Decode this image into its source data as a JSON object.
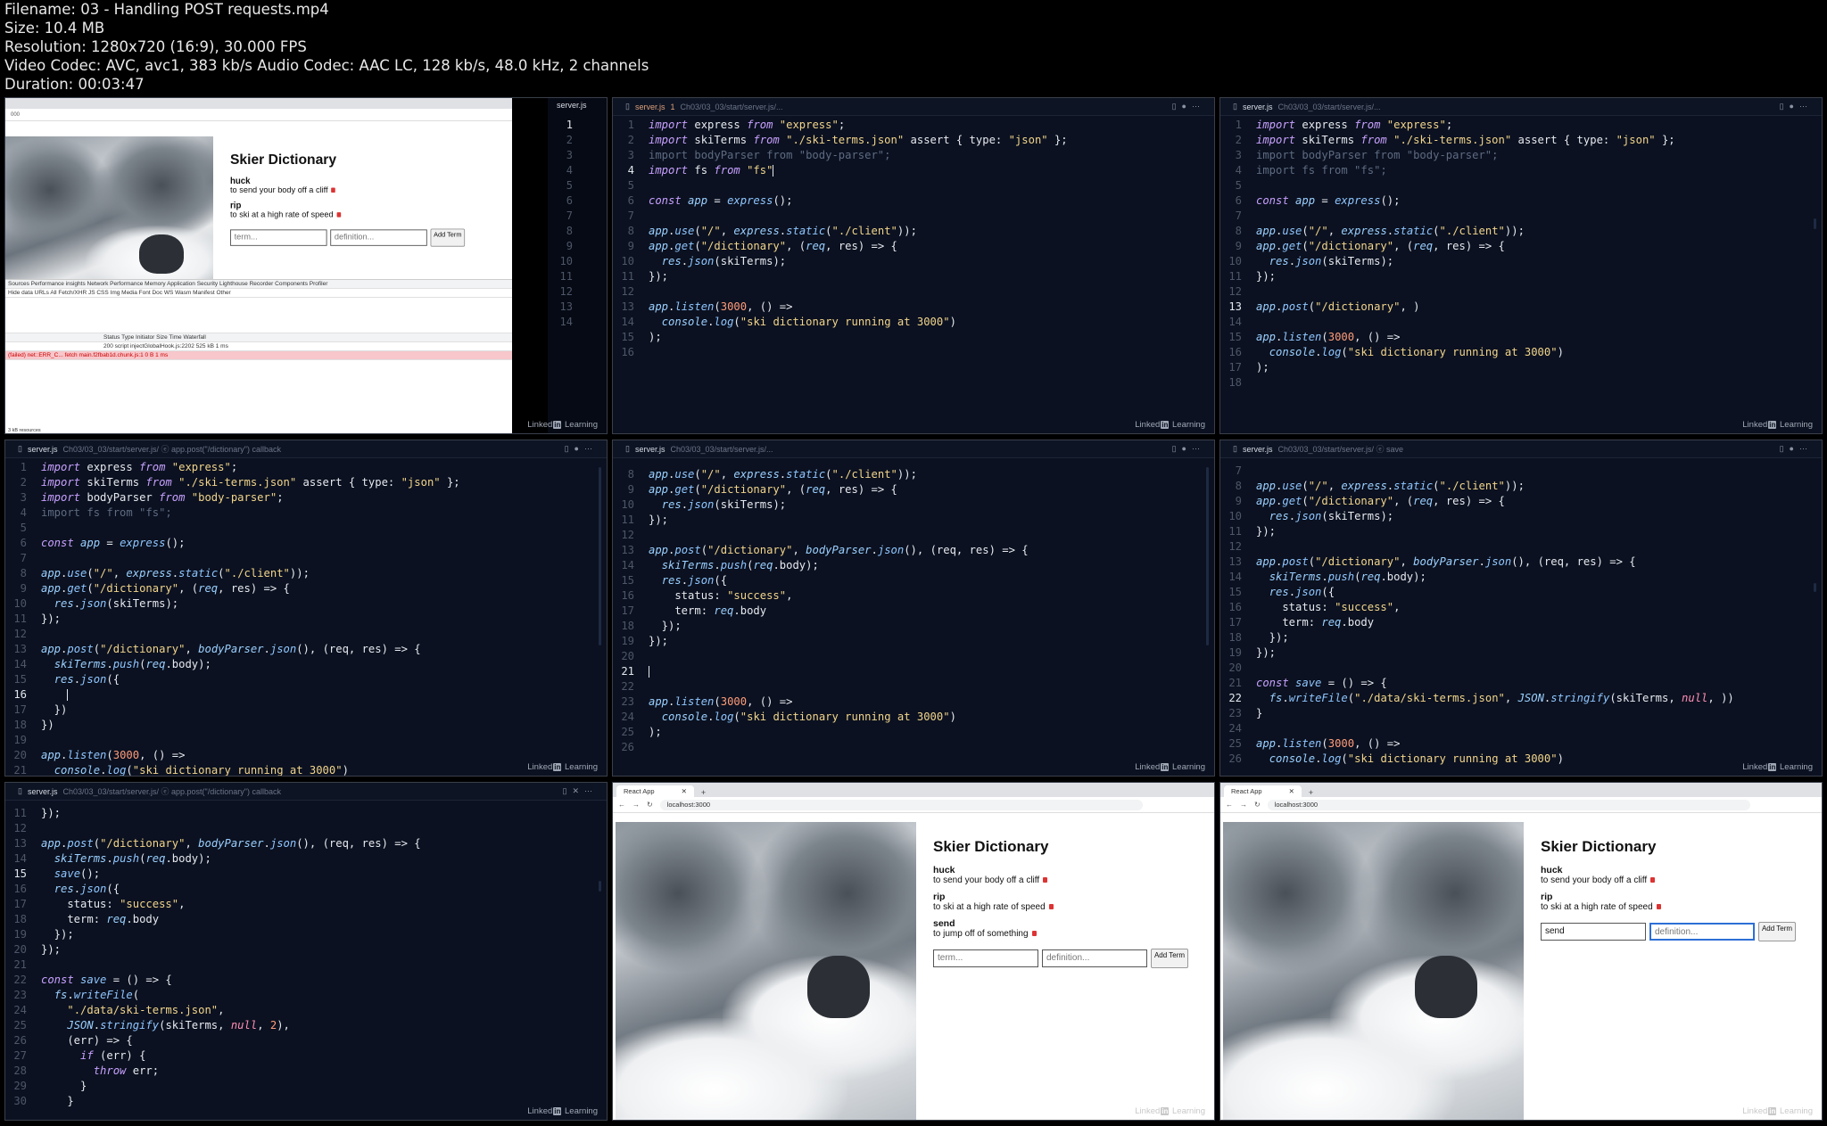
{
  "meta": {
    "filename": "Filename: 03 - Handling POST requests.mp4",
    "size": "Size: 10.4 MB",
    "resolution": "Resolution: 1280x720 (16:9), 30.000 FPS",
    "video": "Video Codec: AVC, avc1, 383 kb/s Audio Codec: AAC LC, 128 kb/s, 48.0 kHz, 2 channels",
    "duration": "Duration: 00:03:47"
  },
  "watermark": "Linked",
  "watermark_in": "in",
  "watermark_tail": "Learning",
  "tiles": {
    "t1": {
      "browser_url": "000",
      "title": "Skier Dictionary",
      "terms": [
        {
          "term": "huck",
          "def": "to send your body off a cliff"
        },
        {
          "term": "rip",
          "def": "to ski at a high rate of speed"
        }
      ],
      "term_ph": "term...",
      "def_ph": "definition...",
      "btn": "Add Term",
      "devtabs": "Sources  Performance insights  Network  Performance  Memory  Application  Security  Lighthouse  Recorder  Components  Profiler",
      "devfilter": "Hide data URLs  All  Fetch/XHR  JS  CSS  Img  Media  Font  Doc  WS  Wasm  Manifest  Other",
      "cols": "Status   Type   Initiator   Size   Time   Waterfall",
      "row1": "200   script   injectGlobalHook.js:2202   525 kB   1 ms",
      "row2": "(failed) net::ERR_C...   fetch   main.f2fbab1d.chunk.js:1   0 B   1 ms",
      "footer": "3 kB resources",
      "side_file": "server.js",
      "side_nums": [
        "1",
        "2",
        "3",
        "4",
        "5",
        "6",
        "7",
        "8",
        "9",
        "10",
        "11",
        "12",
        "13",
        "14"
      ]
    },
    "t2": {
      "file": "server.js",
      "mod": "1",
      "path": "Ch03/03_03/start/server.js/..."
    },
    "t3": {
      "file": "server.js",
      "path": "Ch03/03_03/start/server.js/..."
    },
    "t4": {
      "file": "server.js",
      "path": "Ch03/03_03/start/server.js/ ⓔ app.post(\"/dictionary\") callback"
    },
    "t5": {
      "file": "server.js",
      "path": "Ch03/03_03/start/server.js/..."
    },
    "t6": {
      "file": "server.js",
      "path": "Ch03/03_03/start/server.js/ ⓔ save"
    },
    "t7": {
      "file": "server.js",
      "path": "Ch03/03_03/start/server.js/ ⓔ app.post(\"/dictionary\") callback"
    },
    "t8": {
      "tab": "React App",
      "url": "localhost:3000",
      "title": "Skier Dictionary",
      "terms": [
        {
          "term": "huck",
          "def": "to send your body off a cliff"
        },
        {
          "term": "rip",
          "def": "to ski at a high rate of speed"
        },
        {
          "term": "send",
          "def": "to jump off of something"
        }
      ],
      "term_ph": "term...",
      "def_ph": "definition...",
      "btn": "Add Term"
    },
    "t9": {
      "tab": "React App",
      "url": "localhost:3000",
      "title": "Skier Dictionary",
      "terms": [
        {
          "term": "huck",
          "def": "to send your body off a cliff"
        },
        {
          "term": "rip",
          "def": "to ski at a high rate of speed"
        }
      ],
      "term_value": "send",
      "def_ph": "definition...",
      "btn": "Add Term"
    }
  },
  "code": {
    "t2": [
      {
        "n": "1",
        "h": "<span class='c-imp'>import</span> express <span class='c-imp'>from</span> <span class='c-str'>\"express\"</span>;"
      },
      {
        "n": "2",
        "h": "<span class='c-imp'>import</span> skiTerms <span class='c-imp'>from</span> <span class='c-str'>\"./ski-terms.json\"</span> assert { type: <span class='c-str'>\"json\"</span> };"
      },
      {
        "n": "3",
        "h": "<span class='c-dim'>import bodyParser from \"body-parser\";</span>"
      },
      {
        "n": "4",
        "c": 1,
        "h": "<span class='c-imp'>import</span> fs <span class='c-imp'>from</span> <span class='c-str'>\"fs\"</span><span class='cursor'></span>"
      },
      {
        "n": "5",
        "h": ""
      },
      {
        "n": "6",
        "h": "<span class='c-kw'>const</span> <span class='c-var'>app</span> = <span class='c-fn'>express</span>();"
      },
      {
        "n": "7",
        "h": ""
      },
      {
        "n": "8",
        "h": "<span class='c-var'>app</span>.<span class='c-fn'>use</span>(<span class='c-str'>\"/\"</span>, <span class='c-var'>express</span>.<span class='c-fn'>static</span>(<span class='c-str'>\"./client\"</span>));"
      },
      {
        "n": "9",
        "h": "<span class='c-var'>app</span>.<span class='c-fn'>get</span>(<span class='c-str'>\"/dictionary\"</span>, (<span class='c-var'>req</span>, res) => {"
      },
      {
        "n": "10",
        "h": "  <span class='c-var'>res</span>.<span class='c-fn'>json</span>(skiTerms);"
      },
      {
        "n": "11",
        "h": "});"
      },
      {
        "n": "12",
        "h": ""
      },
      {
        "n": "13",
        "h": "<span class='c-var'>app</span>.<span class='c-fn'>listen</span>(<span class='c-num'>3000</span>, () =>"
      },
      {
        "n": "14",
        "h": "  <span class='c-var'>console</span>.<span class='c-fn'>log</span>(<span class='c-str'>\"ski dictionary running at 3000\"</span>)"
      },
      {
        "n": "15",
        "h": ");"
      },
      {
        "n": "16",
        "h": ""
      }
    ],
    "t3": [
      {
        "n": "1",
        "h": "<span class='c-imp'>import</span> express <span class='c-imp'>from</span> <span class='c-str'>\"express\"</span>;"
      },
      {
        "n": "2",
        "h": "<span class='c-imp'>import</span> skiTerms <span class='c-imp'>from</span> <span class='c-str'>\"./ski-terms.json\"</span> assert { type: <span class='c-str'>\"json\"</span> };"
      },
      {
        "n": "3",
        "h": "<span class='c-dim'>import bodyParser from \"body-parser\";</span>"
      },
      {
        "n": "4",
        "h": "<span class='c-dim'>import fs from \"fs\";</span>"
      },
      {
        "n": "5",
        "h": ""
      },
      {
        "n": "6",
        "h": "<span class='c-kw'>const</span> <span class='c-var'>app</span> = <span class='c-fn'>express</span>();"
      },
      {
        "n": "7",
        "h": ""
      },
      {
        "n": "8",
        "h": "<span class='c-var'>app</span>.<span class='c-fn'>use</span>(<span class='c-str'>\"/\"</span>, <span class='c-var'>express</span>.<span class='c-fn'>static</span>(<span class='c-str'>\"./client\"</span>));"
      },
      {
        "n": "9",
        "h": "<span class='c-var'>app</span>.<span class='c-fn'>get</span>(<span class='c-str'>\"/dictionary\"</span>, (<span class='c-var'>req</span>, res) => {"
      },
      {
        "n": "10",
        "h": "  <span class='c-var'>res</span>.<span class='c-fn'>json</span>(skiTerms);"
      },
      {
        "n": "11",
        "h": "});"
      },
      {
        "n": "12",
        "h": ""
      },
      {
        "n": "13",
        "c": 1,
        "h": "<span class='c-var'>app</span>.<span class='c-fn'>post</span>(<span class='c-str'>\"/dictionary\"</span>, )"
      },
      {
        "n": "14",
        "h": ""
      },
      {
        "n": "15",
        "h": "<span class='c-var'>app</span>.<span class='c-fn'>listen</span>(<span class='c-num'>3000</span>, () =>"
      },
      {
        "n": "16",
        "h": "  <span class='c-var'>console</span>.<span class='c-fn'>log</span>(<span class='c-str'>\"ski dictionary running at 3000\"</span>)"
      },
      {
        "n": "17",
        "h": ");"
      },
      {
        "n": "18",
        "h": ""
      }
    ],
    "t4": [
      {
        "n": "1",
        "h": "<span class='c-imp'>import</span> express <span class='c-imp'>from</span> <span class='c-str'>\"express\"</span>;"
      },
      {
        "n": "2",
        "h": "<span class='c-imp'>import</span> skiTerms <span class='c-imp'>from</span> <span class='c-str'>\"./ski-terms.json\"</span> assert { type: <span class='c-str'>\"json\"</span> };"
      },
      {
        "n": "3",
        "h": "<span class='c-imp'>import</span> bodyParser <span class='c-imp'>from</span> <span class='c-str'>\"body-parser\"</span>;"
      },
      {
        "n": "4",
        "h": "<span class='c-dim'>import fs from \"fs\";</span>"
      },
      {
        "n": "5",
        "h": ""
      },
      {
        "n": "6",
        "h": "<span class='c-kw'>const</span> <span class='c-var'>app</span> = <span class='c-fn'>express</span>();"
      },
      {
        "n": "7",
        "h": ""
      },
      {
        "n": "8",
        "h": "<span class='c-var'>app</span>.<span class='c-fn'>use</span>(<span class='c-str'>\"/\"</span>, <span class='c-var'>express</span>.<span class='c-fn'>static</span>(<span class='c-str'>\"./client\"</span>));"
      },
      {
        "n": "9",
        "h": "<span class='c-var'>app</span>.<span class='c-fn'>get</span>(<span class='c-str'>\"/dictionary\"</span>, (<span class='c-var'>req</span>, res) => {"
      },
      {
        "n": "10",
        "h": "  <span class='c-var'>res</span>.<span class='c-fn'>json</span>(skiTerms);"
      },
      {
        "n": "11",
        "h": "});"
      },
      {
        "n": "12",
        "h": ""
      },
      {
        "n": "13",
        "h": "<span class='c-var'>app</span>.<span class='c-fn'>post</span>(<span class='c-str'>\"/dictionary\"</span>, <span class='c-var'>bodyParser</span>.<span class='c-fn'>json</span>(), (req, res) => {"
      },
      {
        "n": "14",
        "h": "  <span class='c-var'>skiTerms</span>.<span class='c-fn'>push</span>(<span class='c-var'>req</span>.body);"
      },
      {
        "n": "15",
        "h": "  <span class='c-var'>res</span>.<span class='c-fn'>json</span>({"
      },
      {
        "n": "16",
        "c": 1,
        "h": "    <span class='cursor'></span>"
      },
      {
        "n": "17",
        "h": "  })"
      },
      {
        "n": "18",
        "h": "})"
      },
      {
        "n": "19",
        "h": ""
      },
      {
        "n": "20",
        "h": "<span class='c-var'>app</span>.<span class='c-fn'>listen</span>(<span class='c-num'>3000</span>, () =>"
      },
      {
        "n": "21",
        "h": "  <span class='c-var'>console</span>.<span class='c-fn'>log</span>(<span class='c-str'>\"ski dictionary running at 3000\"</span>)"
      }
    ],
    "t5": [
      {
        "n": "8",
        "h": "<span class='c-var'>app</span>.<span class='c-fn'>use</span>(<span class='c-str'>\"/\"</span>, <span class='c-var'>express</span>.<span class='c-fn'>static</span>(<span class='c-str'>\"./client\"</span>));"
      },
      {
        "n": "9",
        "h": "<span class='c-var'>app</span>.<span class='c-fn'>get</span>(<span class='c-str'>\"/dictionary\"</span>, (<span class='c-var'>req</span>, res) => {"
      },
      {
        "n": "10",
        "h": "  <span class='c-var'>res</span>.<span class='c-fn'>json</span>(skiTerms);"
      },
      {
        "n": "11",
        "h": "});"
      },
      {
        "n": "12",
        "h": ""
      },
      {
        "n": "13",
        "h": "<span class='c-var'>app</span>.<span class='c-fn'>post</span>(<span class='c-str'>\"/dictionary\"</span>, <span class='c-var'>bodyParser</span>.<span class='c-fn'>json</span>(), (req, res) => {"
      },
      {
        "n": "14",
        "h": "  <span class='c-var'>skiTerms</span>.<span class='c-fn'>push</span>(<span class='c-var'>req</span>.body);"
      },
      {
        "n": "15",
        "h": "  <span class='c-var'>res</span>.<span class='c-fn'>json</span>({"
      },
      {
        "n": "16",
        "h": "    status: <span class='c-str'>\"success\"</span>,"
      },
      {
        "n": "17",
        "h": "    term: <span class='c-var'>req</span>.body"
      },
      {
        "n": "18",
        "h": "  });"
      },
      {
        "n": "19",
        "h": "});"
      },
      {
        "n": "20",
        "h": ""
      },
      {
        "n": "21",
        "c": 1,
        "h": "<span class='cursor'></span>"
      },
      {
        "n": "22",
        "h": ""
      },
      {
        "n": "23",
        "h": "<span class='c-var'>app</span>.<span class='c-fn'>listen</span>(<span class='c-num'>3000</span>, () =>"
      },
      {
        "n": "24",
        "h": "  <span class='c-var'>console</span>.<span class='c-fn'>log</span>(<span class='c-str'>\"ski dictionary running at 3000\"</span>)"
      },
      {
        "n": "25",
        "h": ");"
      },
      {
        "n": "26",
        "h": ""
      }
    ],
    "t6": [
      {
        "n": "7",
        "h": ""
      },
      {
        "n": "8",
        "h": "<span class='c-var'>app</span>.<span class='c-fn'>use</span>(<span class='c-str'>\"/\"</span>, <span class='c-var'>express</span>.<span class='c-fn'>static</span>(<span class='c-str'>\"./client\"</span>));"
      },
      {
        "n": "9",
        "h": "<span class='c-var'>app</span>.<span class='c-fn'>get</span>(<span class='c-str'>\"/dictionary\"</span>, (<span class='c-var'>req</span>, res) => {"
      },
      {
        "n": "10",
        "h": "  <span class='c-var'>res</span>.<span class='c-fn'>json</span>(skiTerms);"
      },
      {
        "n": "11",
        "h": "});"
      },
      {
        "n": "12",
        "h": ""
      },
      {
        "n": "13",
        "h": "<span class='c-var'>app</span>.<span class='c-fn'>post</span>(<span class='c-str'>\"/dictionary\"</span>, <span class='c-var'>bodyParser</span>.<span class='c-fn'>json</span>(), (req, res) => {"
      },
      {
        "n": "14",
        "h": "  <span class='c-var'>skiTerms</span>.<span class='c-fn'>push</span>(<span class='c-var'>req</span>.body);"
      },
      {
        "n": "15",
        "h": "  <span class='c-var'>res</span>.<span class='c-fn'>json</span>({"
      },
      {
        "n": "16",
        "h": "    status: <span class='c-str'>\"success\"</span>,"
      },
      {
        "n": "17",
        "h": "    term: <span class='c-var'>req</span>.body"
      },
      {
        "n": "18",
        "h": "  });"
      },
      {
        "n": "19",
        "h": "});"
      },
      {
        "n": "20",
        "h": ""
      },
      {
        "n": "21",
        "h": "<span class='c-kw'>const</span> <span class='c-fn'>save</span> = () => {"
      },
      {
        "n": "22",
        "c": 1,
        "h": "  <span class='c-var'>fs</span>.<span class='c-fn'>writeFile</span>(<span class='c-str'>\"./data/ski-terms.json\"</span>, <span class='c-var'>JSON</span>.<span class='c-fn'>stringify</span>(skiTerms, <span class='c-null'>null</span>, ))"
      },
      {
        "n": "23",
        "h": "}"
      },
      {
        "n": "24",
        "h": ""
      },
      {
        "n": "25",
        "h": "<span class='c-var'>app</span>.<span class='c-fn'>listen</span>(<span class='c-num'>3000</span>, () =>"
      },
      {
        "n": "26",
        "h": "  <span class='c-var'>console</span>.<span class='c-fn'>log</span>(<span class='c-str'>\"ski dictionary running at 3000\"</span>)"
      }
    ],
    "t7": [
      {
        "n": "11",
        "h": "});"
      },
      {
        "n": "12",
        "h": ""
      },
      {
        "n": "13",
        "h": "<span class='c-var'>app</span>.<span class='c-fn'>post</span>(<span class='c-str'>\"/dictionary\"</span>, <span class='c-var'>bodyParser</span>.<span class='c-fn'>json</span>(), (req, res) => {"
      },
      {
        "n": "14",
        "h": "  <span class='c-var'>skiTerms</span>.<span class='c-fn'>push</span>(<span class='c-var'>req</span>.body);"
      },
      {
        "n": "15",
        "c": 1,
        "h": "  <span class='c-fn'>save</span>();"
      },
      {
        "n": "16",
        "h": "  <span class='c-var'>res</span>.<span class='c-fn'>json</span>({"
      },
      {
        "n": "17",
        "h": "    status: <span class='c-str'>\"success\"</span>,"
      },
      {
        "n": "18",
        "h": "    term: <span class='c-var'>req</span>.body"
      },
      {
        "n": "19",
        "h": "  });"
      },
      {
        "n": "20",
        "h": "});"
      },
      {
        "n": "21",
        "h": ""
      },
      {
        "n": "22",
        "h": "<span class='c-kw'>const</span> <span class='c-fn'>save</span> = () => {"
      },
      {
        "n": "23",
        "h": "  <span class='c-var'>fs</span>.<span class='c-fn'>writeFile</span>("
      },
      {
        "n": "24",
        "h": "    <span class='c-str'>\"./data/ski-terms.json\"</span>,"
      },
      {
        "n": "25",
        "h": "    <span class='c-var'>JSON</span>.<span class='c-fn'>stringify</span>(skiTerms, <span class='c-null'>null</span>, <span class='c-num'>2</span>),"
      },
      {
        "n": "26",
        "h": "    (err) => {"
      },
      {
        "n": "27",
        "h": "      <span class='c-kw'>if</span> (err) {"
      },
      {
        "n": "28",
        "h": "        <span class='c-kw'>throw</span> err;"
      },
      {
        "n": "29",
        "h": "      }"
      },
      {
        "n": "30",
        "h": "    }"
      }
    ]
  }
}
